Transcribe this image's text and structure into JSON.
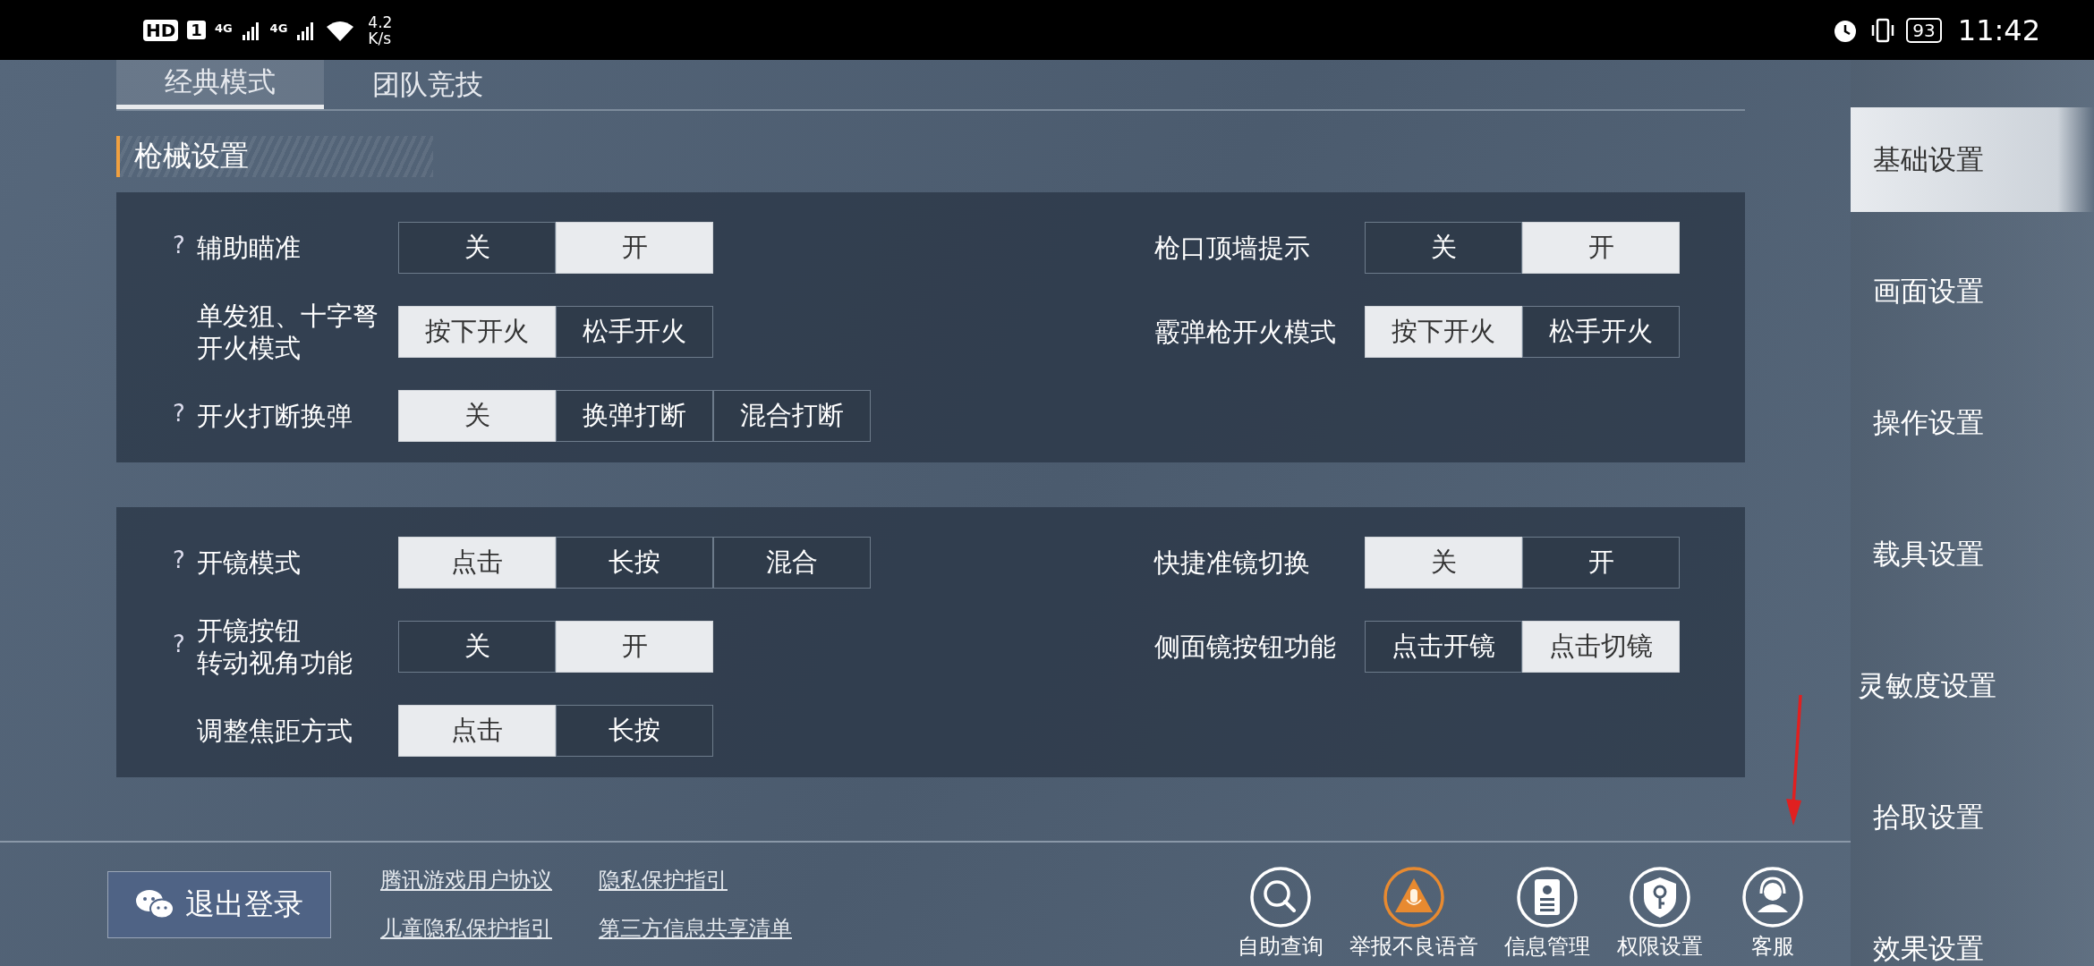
{
  "status_bar": {
    "left": {
      "hd": "HD",
      "sim": "1",
      "net1": "4G",
      "net2": "4G",
      "speed_value": "4.2",
      "speed_unit": "K/s"
    },
    "right": {
      "battery": "93",
      "time": "11:42"
    }
  },
  "tabs": [
    {
      "label": "经典模式",
      "selected": true
    },
    {
      "label": "团队竞技",
      "selected": false
    }
  ],
  "section": {
    "title": "枪械设置"
  },
  "cards": [
    {
      "left": [
        {
          "help": "?",
          "label": "辅助瞄准",
          "options": [
            {
              "label": "关",
              "selected": false
            },
            {
              "label": "开",
              "selected": true
            }
          ]
        },
        {
          "lines": [
            "单发狙、十字弩",
            "开火模式"
          ],
          "options": [
            {
              "label": "按下开火",
              "selected": true
            },
            {
              "label": "松手开火",
              "selected": false
            }
          ]
        },
        {
          "help": "?",
          "label": "开火打断换弹",
          "options": [
            {
              "label": "关",
              "selected": true
            },
            {
              "label": "换弹打断",
              "selected": false
            },
            {
              "label": "混合打断",
              "selected": false
            }
          ]
        }
      ],
      "right": [
        {
          "label": "枪口顶墙提示",
          "options": [
            {
              "label": "关",
              "selected": false
            },
            {
              "label": "开",
              "selected": true
            }
          ]
        },
        {
          "label": "霰弹枪开火模式",
          "options": [
            {
              "label": "按下开火",
              "selected": true
            },
            {
              "label": "松手开火",
              "selected": false
            }
          ]
        }
      ]
    },
    {
      "left": [
        {
          "help": "?",
          "label": "开镜模式",
          "options": [
            {
              "label": "点击",
              "selected": true
            },
            {
              "label": "长按",
              "selected": false
            },
            {
              "label": "混合",
              "selected": false
            }
          ]
        },
        {
          "help": "?",
          "lines": [
            "开镜按钮",
            "转动视角功能"
          ],
          "options": [
            {
              "label": "关",
              "selected": false
            },
            {
              "label": "开",
              "selected": true
            }
          ]
        },
        {
          "label": "调整焦距方式",
          "options": [
            {
              "label": "点击",
              "selected": true
            },
            {
              "label": "长按",
              "selected": false
            }
          ]
        }
      ],
      "right": [
        {
          "label": "快捷准镜切换",
          "options": [
            {
              "label": "关",
              "selected": true
            },
            {
              "label": "开",
              "selected": false
            }
          ]
        },
        {
          "label": "侧面镜按钮功能",
          "options": [
            {
              "label": "点击开镜",
              "selected": false
            },
            {
              "label": "点击切镜",
              "selected": true
            }
          ]
        }
      ]
    }
  ],
  "footer": {
    "logout": "退出登录",
    "links": [
      "腾讯游戏用户协议",
      "隐私保护指引",
      "儿童隐私保护指引",
      "第三方信息共享清单"
    ],
    "actions": [
      {
        "kind": "search",
        "label": "自助查询"
      },
      {
        "kind": "report",
        "label": "举报不良语音"
      },
      {
        "kind": "profile",
        "label": "信息管理"
      },
      {
        "kind": "permission",
        "label": "权限设置"
      },
      {
        "kind": "service",
        "label": "客服"
      }
    ]
  },
  "sidebar": {
    "items": [
      {
        "label": "基础设置",
        "selected": true
      },
      {
        "label": "画面设置",
        "selected": false
      },
      {
        "label": "操作设置",
        "selected": false
      },
      {
        "label": "载具设置",
        "selected": false
      },
      {
        "label": "灵敏度设置",
        "selected": false
      },
      {
        "label": "拾取设置",
        "selected": false
      },
      {
        "label": "效果设置",
        "selected": false
      }
    ]
  }
}
